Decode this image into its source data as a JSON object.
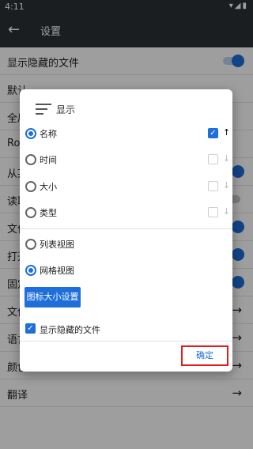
{
  "status_bar": {
    "time": "4:11",
    "icons": [
      "wifi-icon",
      "signal-icon",
      "battery-icon"
    ]
  },
  "app_bar": {
    "title": "设置",
    "back_icon": "arrow-left-icon"
  },
  "settings": [
    {
      "label": "显示隐藏的文件",
      "control": "switch",
      "on": true
    },
    {
      "label": "默认",
      "control": "none"
    },
    {
      "label": "全局",
      "control": "none"
    },
    {
      "label": "Root",
      "control": "none"
    },
    {
      "label": "从某",
      "control": "switch",
      "on": true
    },
    {
      "label": "读取",
      "control": "switch",
      "on": false
    },
    {
      "label": "文件",
      "control": "switch",
      "on": true
    },
    {
      "label": "打开",
      "control": "switch",
      "on": true
    },
    {
      "label": "固定",
      "control": "switch",
      "on": true
    },
    {
      "label": "文件搜索引擎",
      "control": "arrow"
    },
    {
      "label": "语言",
      "control": "arrow"
    },
    {
      "label": "颜色",
      "control": "arrow"
    },
    {
      "label": "翻译",
      "control": "arrow"
    }
  ],
  "dialog": {
    "title": "显示",
    "icon": "sort-icon",
    "sort_options": [
      {
        "label": "名称",
        "selected": true,
        "checkbox": true,
        "arrow": "↑"
      },
      {
        "label": "时间",
        "selected": false,
        "checkbox": false,
        "arrow": "↓"
      },
      {
        "label": "大小",
        "selected": false,
        "checkbox": false,
        "arrow": "↓"
      },
      {
        "label": "类型",
        "selected": false,
        "checkbox": false,
        "arrow": "↓"
      }
    ],
    "view_options": [
      {
        "label": "列表视图",
        "selected": false
      },
      {
        "label": "网格视图",
        "selected": true
      }
    ],
    "icon_size_button": "图标大小设置",
    "show_hidden_label": "显示隐藏的文件",
    "show_hidden_checked": true,
    "ok_button": "确定"
  },
  "colors": {
    "accent": "#1e6fd9",
    "appbar": "#2d3135",
    "highlight": "#e21d1d"
  }
}
